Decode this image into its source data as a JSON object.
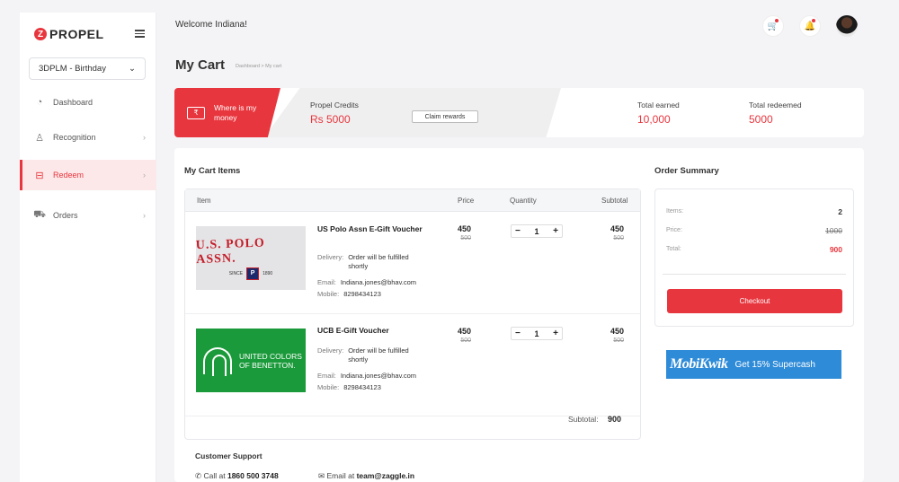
{
  "brand": {
    "logo_text": "PROPEL",
    "logo_mark": "Z"
  },
  "sidebar": {
    "program_selector": "3DPLM - Birthday",
    "items": [
      {
        "label": "Dashboard",
        "icon": "dashboard-icon",
        "active": false,
        "has_submenu": false
      },
      {
        "label": "Recognition",
        "icon": "recognition-icon",
        "active": false,
        "has_submenu": true
      },
      {
        "label": "Redeem",
        "icon": "gift-icon",
        "active": true,
        "has_submenu": true
      },
      {
        "label": "Orders",
        "icon": "cart-icon",
        "active": false,
        "has_submenu": true
      }
    ]
  },
  "header": {
    "welcome": "Welcome Indiana!"
  },
  "page": {
    "title": "My Cart",
    "breadcrumb": "Dashboard > My cart"
  },
  "credits": {
    "where_label": "Where is my money",
    "propel_credits_label": "Propel Credits",
    "propel_credits_value": "Rs 5000",
    "claim_label": "Claim rewards",
    "total_earned_label": "Total earned",
    "total_earned_value": "10,000",
    "total_redeemed_label": "Total redeemed",
    "total_redeemed_value": "5000"
  },
  "cart": {
    "title": "My Cart Items",
    "columns": [
      "Item",
      "Price",
      "Quantity",
      "Subtotal"
    ],
    "items": [
      {
        "brand_text": "U.S. POLO ASSN.",
        "brand_sub_left": "SINCE",
        "brand_sub_right": "1890",
        "name": "US Polo Assn E-Gift Voucher",
        "delivery_label": "Delivery:",
        "delivery": "Order will be fulfilled shortly",
        "email_label": "Email:",
        "email": "Indiana.jones@bhav.com",
        "mobile_label": "Mobile:",
        "mobile": "8298434123",
        "price": "450",
        "original_price": "500",
        "quantity": "1",
        "subtotal": "450",
        "subtotal_original": "500"
      },
      {
        "brand_text": "UNITED COLORS OF BENETTON.",
        "name": "UCB E-Gift Voucher",
        "delivery_label": "Delivery:",
        "delivery": "Order will be fulfilled shortly",
        "email_label": "Email:",
        "email": "Indiana.jones@bhav.com",
        "mobile_label": "Mobile:",
        "mobile": "8298434123",
        "price": "450",
        "original_price": "500",
        "quantity": "1",
        "subtotal": "450",
        "subtotal_original": "500"
      }
    ],
    "subtotal_label": "Subtotal:",
    "subtotal_value": "900"
  },
  "summary": {
    "title": "Order Summary",
    "items_label": "Items:",
    "items_value": "2",
    "price_label": "Price:",
    "price_value": "1000",
    "total_label": "Total:",
    "total_value": "900",
    "checkout_label": "Checkout"
  },
  "promo": {
    "brand": "MobiKwik",
    "text": "Get 15% Supercash"
  },
  "support": {
    "title": "Customer Support",
    "call_prefix": "Call at",
    "call_number": "1860 500 3748",
    "email_prefix": "Email at",
    "email_address": "team@zaggle.in"
  },
  "colors": {
    "accent": "#e8363e",
    "promo": "#2e8bd8",
    "ucb": "#1a9a3a"
  }
}
